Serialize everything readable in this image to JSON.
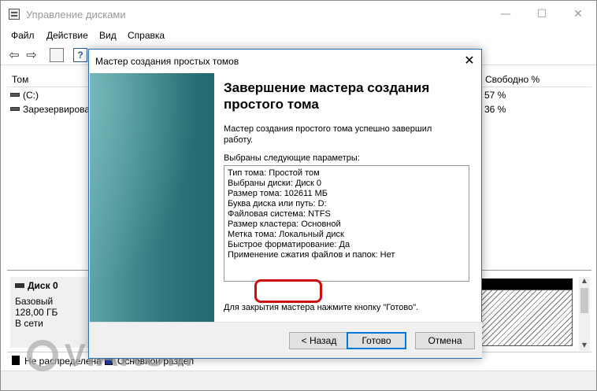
{
  "app": {
    "title": "Управление дисками",
    "controls": {
      "minimize": "—",
      "maximize": "☐",
      "close": "✕"
    }
  },
  "menu": [
    "Файл",
    "Действие",
    "Вид",
    "Справка"
  ],
  "toolbar": {
    "back": "⇦",
    "forward": "⇨",
    "help": "?"
  },
  "volume_list": {
    "columns": {
      "name": "Том",
      "free": "Свободно %"
    },
    "rows": [
      {
        "name": "(C:)",
        "free": "57 %"
      },
      {
        "name": "Зарезервирова",
        "free": "36 %"
      }
    ]
  },
  "disk": {
    "title": "Диск 0",
    "type": "Базовый",
    "size": "128,00 ГБ",
    "status": "В сети"
  },
  "legend": [
    {
      "label": "Не распределена",
      "color": "#000000"
    },
    {
      "label": "Основной раздел",
      "color": "#1d3f9e"
    }
  ],
  "watermark": "VIARUM",
  "dialog": {
    "title": "Мастер создания простых томов",
    "close": "✕",
    "heading": "Завершение мастера создания простого тома",
    "description": "Мастер создания простого тома успешно завершил работу.",
    "params_label": "Выбраны следующие параметры:",
    "params": [
      "Тип тома: Простой том",
      "Выбраны диски: Диск 0",
      "Размер тома: 102611 МБ",
      "Буква диска или путь: D:",
      "Файловая система: NTFS",
      "Размер кластера: Основной",
      "Метка тома: Локальный диск",
      "Быстрое форматирование: Да",
      "Применение сжатия файлов и папок: Нет"
    ],
    "close_hint": "Для закрытия мастера нажмите кнопку \"Готово\".",
    "buttons": {
      "back": "< Назад",
      "finish": "Готово",
      "cancel": "Отмена"
    }
  }
}
